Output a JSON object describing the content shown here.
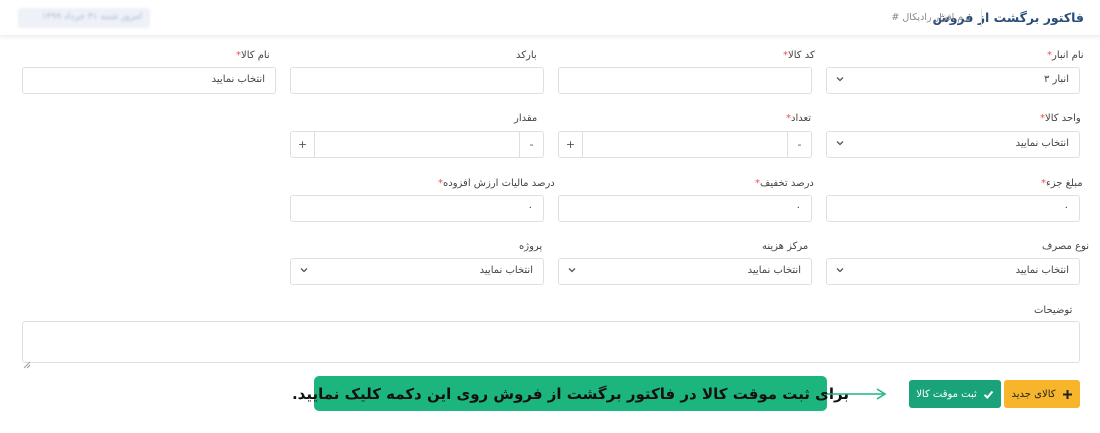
{
  "header": {
    "title": "فاکتور برگشت از فروش",
    "breadcrumb": "# نرم افزار رادیکال",
    "date_text": "امروز شنبه ۳۱ خرداد ۱۳۹۹"
  },
  "form": {
    "warehouse": {
      "label": "نام انبار",
      "required": "*",
      "value": "انبار ۳"
    },
    "item_code": {
      "label": "کد کالا",
      "required": "*",
      "value": ""
    },
    "barcode": {
      "label": "بارکد",
      "value": ""
    },
    "item_name": {
      "label": "نام کالا",
      "required": "*",
      "value": "انتخاب نمایید"
    },
    "unit": {
      "label": "واحد کالا",
      "required": "*",
      "value": "انتخاب نمایید"
    },
    "count": {
      "label": "تعداد",
      "required": "*",
      "value": "",
      "plus": "+",
      "minus": "-"
    },
    "amount": {
      "label": "مقدار",
      "value": "",
      "plus": "+",
      "minus": "-"
    },
    "unit_price": {
      "label": "مبلغ جزء",
      "required": "*",
      "value": "۰"
    },
    "discount": {
      "label": "درصد تخفیف",
      "required": "*",
      "value": "۰"
    },
    "vat": {
      "label": "درصد مالیات ارزش افزوده",
      "required": "*",
      "value": "۰"
    },
    "usage_type": {
      "label": "نوع مصرف",
      "value": "انتخاب نمایید"
    },
    "cost_center": {
      "label": "مرکز هزینه",
      "value": "انتخاب نمایید"
    },
    "project": {
      "label": "پروژه",
      "value": "انتخاب نمایید"
    },
    "description": {
      "label": "توضیحات",
      "value": ""
    }
  },
  "actions": {
    "new_item_label": "کالای جدید",
    "temp_save_label": "ثبت موقت کالا"
  },
  "callout": {
    "text": "برای ثبت موقت کالا در فاکتور برگشت از فروش روی این دکمه کلیک نمایید."
  },
  "colors": {
    "title": "#2a4d7a",
    "required": "#e55353",
    "save_button": "#1aa37a",
    "new_button": "#f7b52c",
    "callout": "#1db57e"
  }
}
